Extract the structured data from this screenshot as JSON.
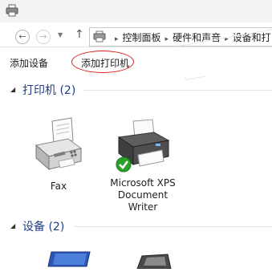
{
  "icons": {
    "title": "printer-icon",
    "back": "back-arrow-icon",
    "forward": "forward-arrow-icon",
    "recent": "chevron-down-icon",
    "up": "up-arrow-icon",
    "address": "devices-and-printers-icon",
    "collapse": "collapse-triangle-icon",
    "breadcrumb_separator": "chevron-right-icon"
  },
  "nav": {
    "back_glyph": "←",
    "forward_glyph": "→",
    "recent_glyph": "▼",
    "up_glyph": "↑"
  },
  "address": {
    "separator_glyph": "▸",
    "crumbs": [
      "控制面板",
      "硬件和声音",
      "设备和打"
    ]
  },
  "toolbar": {
    "add_device": "添加设备",
    "add_printer": "添加打印机"
  },
  "sections": {
    "printers": {
      "title": "打印机 (2)",
      "collapse_glyph": "◢",
      "items": [
        {
          "label": "Fax"
        },
        {
          "label": "Microsoft XPS\nDocument\nWriter",
          "default": true
        }
      ]
    },
    "devices": {
      "title": "设备 (2)",
      "collapse_glyph": "◢"
    }
  },
  "colors": {
    "annotation_ellipse": "#d81e1e",
    "section_title": "#1e3d8a",
    "default_check": "#2aa22a"
  }
}
